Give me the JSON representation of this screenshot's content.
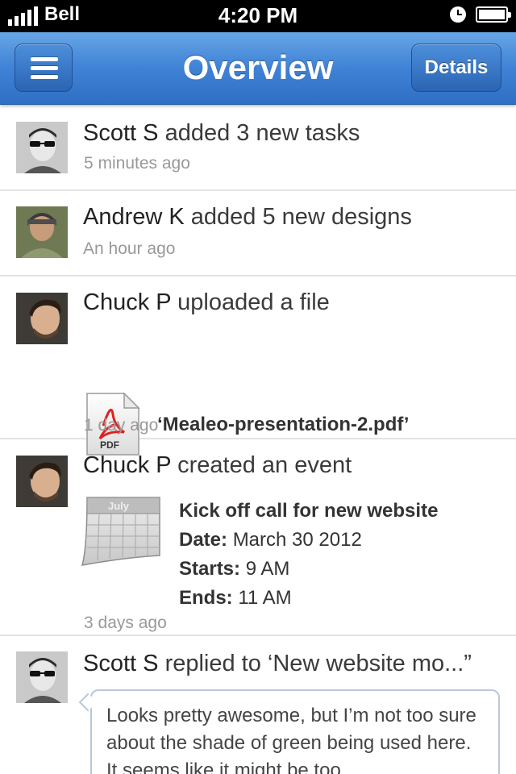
{
  "status_bar": {
    "carrier": "Bell",
    "time": "4:20 PM"
  },
  "nav": {
    "title": "Overview",
    "details_label": "Details"
  },
  "feed": [
    {
      "user": "Scott S",
      "action": "added 3 new tasks",
      "time": "5 minutes ago"
    },
    {
      "user": "Andrew K",
      "action": "added 5 new designs",
      "time": "An hour ago"
    },
    {
      "user": "Chuck P",
      "action": "uploaded a file",
      "file": "‘Mealeo-presentation-2.pdf’",
      "file_icon_label": "PDF",
      "time": "1 day ago"
    },
    {
      "user": "Chuck P",
      "action": "created an event",
      "calendar_month": "July",
      "event_title": "Kick off call for new website",
      "date_label": "Date:",
      "date_value": "March 30 2012",
      "starts_label": "Starts:",
      "starts_value": "9 AM",
      "ends_label": "Ends:",
      "ends_value": "11 AM",
      "time": "3 days ago"
    },
    {
      "user": "Scott S",
      "action": "replied to ‘New website mo...”",
      "reply": "Looks pretty awesome, but I’m not too sure about the shade of green being used here. It seems like it might be too"
    }
  ]
}
